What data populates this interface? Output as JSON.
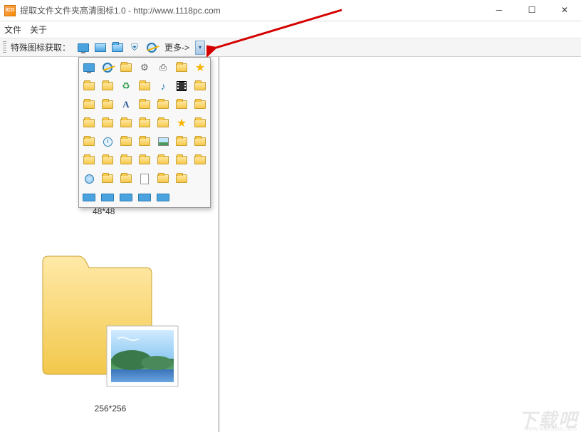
{
  "window": {
    "title": "提取文件文件夹高清图标1.0 - http://www.1118pc.com",
    "app_icon_text": "ICO"
  },
  "menubar": {
    "file": "文件",
    "about": "关于"
  },
  "toolbar": {
    "label": "特殊图标获取：",
    "items": [
      {
        "name": "monitor-icon"
      },
      {
        "name": "desktop-icon"
      },
      {
        "name": "folder-blue-icon"
      },
      {
        "name": "shield-icon"
      },
      {
        "name": "ie-icon"
      }
    ],
    "more_label": "更多->"
  },
  "popup": {
    "rows": [
      [
        "monitor",
        "ie",
        "folder",
        "gear",
        "printer",
        "folder",
        "star"
      ],
      [
        "folder",
        "folder",
        "recycle",
        "folder",
        "music",
        "film",
        "folder"
      ],
      [
        "folder",
        "folder",
        "a",
        "folder",
        "folder",
        "folder",
        "folder"
      ],
      [
        "folder",
        "folder",
        "folder",
        "folder",
        "folder",
        "star",
        "folder"
      ],
      [
        "folder",
        "clock",
        "folder",
        "folder",
        "pic",
        "folder",
        "folder"
      ],
      [
        "folder",
        "folder",
        "folder",
        "folder",
        "folder",
        "folder",
        "folder"
      ],
      [
        "globe",
        "folder",
        "folder",
        "doc",
        "folder",
        "folder",
        ""
      ],
      [
        "monitor-wide",
        "monitor-wide",
        "monitor-wide",
        "monitor-wide",
        "monitor-wide",
        "",
        ""
      ]
    ]
  },
  "thumbs": {
    "small_label": "48*48",
    "large_label": "256*256"
  },
  "watermark": {
    "main": "下载吧",
    "sub": "www.xiazaiba.com"
  }
}
